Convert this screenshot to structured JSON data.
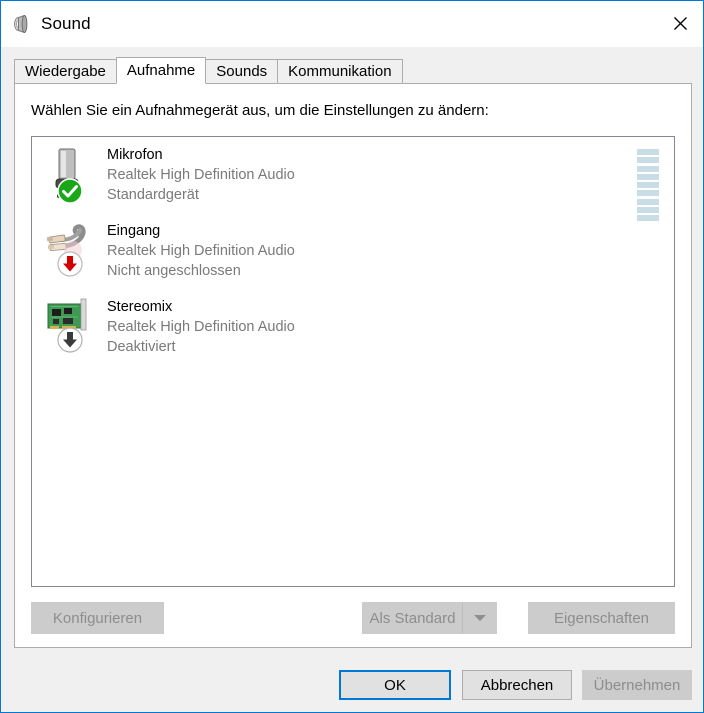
{
  "window": {
    "title": "Sound",
    "icon": "speaker-icon",
    "close_label": "✕",
    "accent_color": "#0078d7"
  },
  "tabs": [
    {
      "label": "Wiedergabe",
      "active": false
    },
    {
      "label": "Aufnahme",
      "active": true
    },
    {
      "label": "Sounds",
      "active": false
    },
    {
      "label": "Kommunikation",
      "active": false
    }
  ],
  "main": {
    "instruction": "Wählen Sie ein Aufnahmegerät aus, um die Einstellungen zu ändern:"
  },
  "devices": [
    {
      "name": "Mikrofon",
      "driver": "Realtek High Definition Audio",
      "status": "Standardgerät",
      "icon": "microphone-icon",
      "badge": "green-check-badge",
      "badge_color": "#18a818",
      "has_meter": true,
      "meter_segments": 9
    },
    {
      "name": "Eingang",
      "driver": "Realtek High Definition Audio",
      "status": "Nicht angeschlossen",
      "icon": "rca-cable-icon",
      "badge": "red-down-arrow-badge",
      "badge_color": "#d40000",
      "has_meter": false,
      "meter_segments": 0
    },
    {
      "name": "Stereomix",
      "driver": "Realtek High Definition Audio",
      "status": "Deaktiviert",
      "icon": "sound-card-icon",
      "badge": "gray-down-arrow-badge",
      "badge_color": "#3a3a3a",
      "has_meter": false,
      "meter_segments": 0
    }
  ],
  "device_buttons": {
    "configure": "Konfigurieren",
    "set_default": "Als Standard",
    "set_default_dropdown": "chevron-down-icon",
    "properties": "Eigenschaften"
  },
  "dialog_buttons": {
    "ok": "OK",
    "cancel": "Abbrechen",
    "apply": "Übernehmen"
  },
  "meter_color": "#c8dde6"
}
